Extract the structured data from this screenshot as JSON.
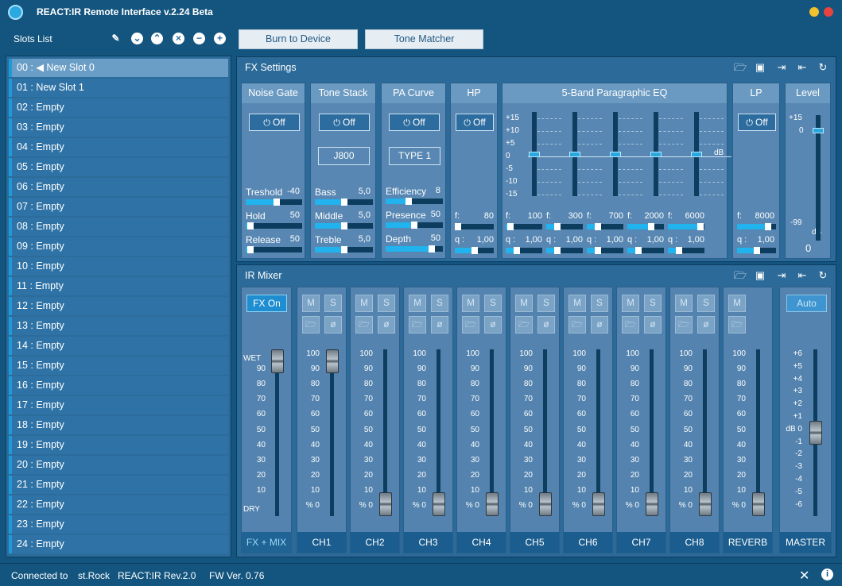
{
  "app": {
    "title": "REACT:IR Remote Interface v.2.24 Beta"
  },
  "slots": {
    "header": "Slots List",
    "items": [
      "00 : ◀ New Slot 0",
      "01 : New Slot 1",
      "02 : Empty",
      "03 : Empty",
      "04 : Empty",
      "05 : Empty",
      "06 : Empty",
      "07 : Empty",
      "08 : Empty",
      "09 : Empty",
      "10 : Empty",
      "11 : Empty",
      "12 : Empty",
      "13 : Empty",
      "14 : Empty",
      "15 : Empty",
      "16 : Empty",
      "17 : Empty",
      "18 : Empty",
      "19 : Empty",
      "20 : Empty",
      "21 : Empty",
      "22 : Empty",
      "23 : Empty",
      "24 : Empty"
    ]
  },
  "toolbar": {
    "burn": "Burn to Device",
    "tone": "Tone Matcher"
  },
  "fx": {
    "title": "FX Settings",
    "noise_gate": {
      "title": "Noise Gate",
      "power": "Off",
      "params": [
        {
          "label": "Treshold",
          "value": "-40",
          "level": 0.55
        },
        {
          "label": "Hold",
          "value": "50",
          "level": 0.05
        },
        {
          "label": "Release",
          "value": "50",
          "level": 0.05
        }
      ]
    },
    "tone_stack": {
      "title": "Tone Stack",
      "power": "Off",
      "model": "J800",
      "params": [
        {
          "label": "Bass",
          "value": "5,0",
          "level": 0.5
        },
        {
          "label": "Middle",
          "value": "5,0",
          "level": 0.5
        },
        {
          "label": "Treble",
          "value": "5,0",
          "level": 0.5
        }
      ]
    },
    "pa_curve": {
      "title": "PA Curve",
      "power": "Off",
      "type": "TYPE 1",
      "params": [
        {
          "label": "Efficiency",
          "value": "8",
          "level": 0.4
        },
        {
          "label": "Presence",
          "value": "50",
          "level": 0.5
        },
        {
          "label": "Depth",
          "value": "50",
          "level": 0.8
        }
      ]
    },
    "hp": {
      "title": "HP",
      "power": "Off",
      "f_label": "f:",
      "f_value": "80",
      "q_label": "q :",
      "q_value": "1,00",
      "f_level": 0.08,
      "q_level": 0.5
    },
    "eq": {
      "title": "5-Band Paragraphic EQ",
      "ticks": [
        "+15",
        "+10",
        "+5",
        "0",
        "-5",
        "-10",
        "-15"
      ],
      "unit": "dB",
      "bands": [
        {
          "f": "100",
          "q": "1,00",
          "gain": 0,
          "f_level": 0.05,
          "q_level": 0.3
        },
        {
          "f": "300",
          "q": "1,00",
          "gain": 0,
          "f_level": 0.3,
          "q_level": 0.3
        },
        {
          "f": "700",
          "q": "1,00",
          "gain": 0,
          "f_level": 0.3,
          "q_level": 0.3
        },
        {
          "f": "2000",
          "q": "1,00",
          "gain": 0,
          "f_level": 0.65,
          "q_level": 0.3
        },
        {
          "f": "6000",
          "q": "1,00",
          "gain": 0,
          "f_level": 0.9,
          "q_level": 0.3
        }
      ],
      "f_label": "f:",
      "q_label": "q :"
    },
    "lp": {
      "title": "LP",
      "power": "Off",
      "f_label": "f:",
      "f_value": "8000",
      "q_label": "q :",
      "q_value": "1,00",
      "f_level": 0.8,
      "q_level": 0.5
    },
    "level": {
      "title": "Level",
      "ticks": [
        "+15",
        "0",
        "-99"
      ],
      "unit": "dB",
      "value": "0"
    }
  },
  "mixer": {
    "title": "IR Mixer",
    "fx_on": "FX On",
    "fx_label": "FX + MIX",
    "wet": "WET",
    "dry": "DRY",
    "scale": [
      "100",
      "90",
      "80",
      "70",
      "60",
      "50",
      "40",
      "30",
      "20",
      "10",
      "% 0"
    ],
    "fx_scale": [
      "90",
      "80",
      "70",
      "60",
      "50",
      "40",
      "30",
      "20",
      "10"
    ],
    "m": "M",
    "s": "S",
    "channels": [
      {
        "name": "CH1",
        "level": 1.0
      },
      {
        "name": "CH2",
        "level": 0
      },
      {
        "name": "CH3",
        "level": 0
      },
      {
        "name": "CH4",
        "level": 0
      },
      {
        "name": "CH5",
        "level": 0
      },
      {
        "name": "CH6",
        "level": 0
      },
      {
        "name": "CH7",
        "level": 0
      },
      {
        "name": "CH8",
        "level": 0
      }
    ],
    "reverb": {
      "name": "REVERB",
      "level": 0
    },
    "master": {
      "name": "MASTER",
      "auto": "Auto",
      "scale": [
        "+6",
        "+5",
        "+4",
        "+3",
        "+2",
        "+1",
        "dB 0",
        "-1",
        "-2",
        "-3",
        "-4",
        "-5",
        "-6"
      ]
    }
  },
  "status": {
    "connected": "Connected to",
    "device": "st.Rock",
    "rev": "REACT:IR Rev.2.0",
    "fw": "FW Ver. 0.76"
  }
}
